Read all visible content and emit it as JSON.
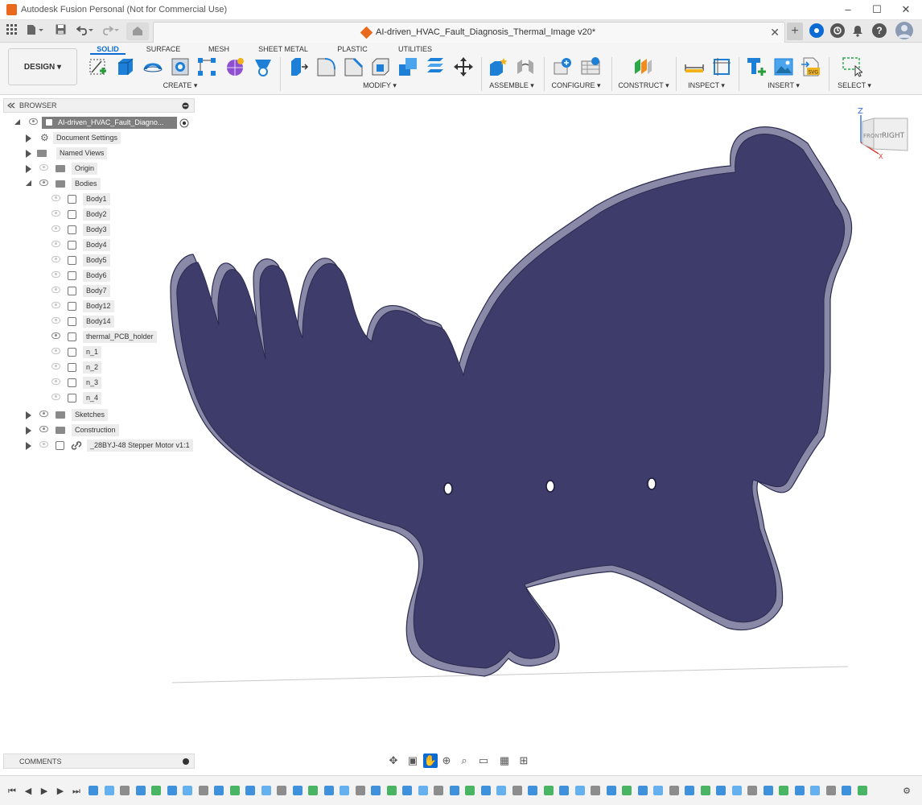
{
  "window": {
    "title": "Autodesk Fusion Personal (Not for Commercial Use)",
    "minimize": "–",
    "maximize": "☐",
    "close": "✕"
  },
  "tabbar": {
    "doc_title": "AI-driven_HVAC_Fault_Diagnosis_Thermal_Image v20*",
    "close": "✕",
    "new_tab": "+",
    "avatar_initial": "",
    "accent_blue": "#0b6bd3"
  },
  "ribbon": {
    "workspace": "DESIGN ▾",
    "tabs": [
      "SOLID",
      "SURFACE",
      "MESH",
      "SHEET METAL",
      "PLASTIC",
      "UTILITIES"
    ],
    "groups": [
      "CREATE ▾",
      "MODIFY ▾",
      "ASSEMBLE ▾",
      "CONFIGURE ▾",
      "CONSTRUCT ▾",
      "INSPECT ▾",
      "INSERT ▾",
      "SELECT ▾"
    ]
  },
  "browser": {
    "header": "BROWSER",
    "root": "AI-driven_HVAC_Fault_Diagno...",
    "items": [
      {
        "label": "Document Settings"
      },
      {
        "label": "Named Views"
      },
      {
        "label": "Origin"
      },
      {
        "label": "Bodies"
      },
      {
        "label": "Body1"
      },
      {
        "label": "Body2"
      },
      {
        "label": "Body3"
      },
      {
        "label": "Body4"
      },
      {
        "label": "Body5"
      },
      {
        "label": "Body6"
      },
      {
        "label": "Body7"
      },
      {
        "label": "Body12"
      },
      {
        "label": "Body14"
      },
      {
        "label": "thermal_PCB_holder"
      },
      {
        "label": "n_1"
      },
      {
        "label": "n_2"
      },
      {
        "label": "n_3"
      },
      {
        "label": "n_4"
      },
      {
        "label": "Sketches"
      },
      {
        "label": "Construction"
      },
      {
        "label": "_28BYJ-48 Stepper Motor v1:1"
      }
    ]
  },
  "comments": {
    "label": "COMMENTS"
  },
  "viewcube": {
    "front": "FRONT",
    "right": "RIGHT",
    "z_axis": "Z",
    "x_axis": "X"
  },
  "model": {
    "fill": "#3e3c6b",
    "edge": "#2b2a4f",
    "side": "#8a8aa8"
  }
}
